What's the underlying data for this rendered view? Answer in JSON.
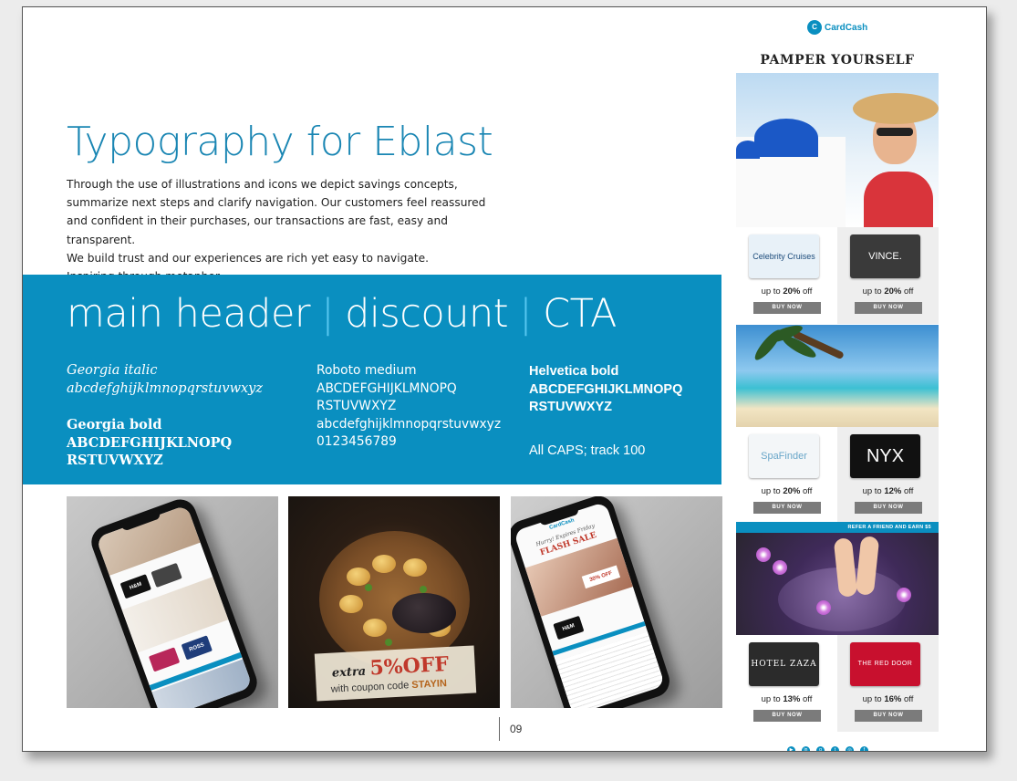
{
  "page": {
    "title": "Typography for Eblast",
    "intro": [
      "Through the use of illustrations and icons we depict savings concepts,",
      "summarize next steps and clarify navigation. Our customers feel reassured",
      "and confident in their purchases, our transactions are fast, easy and transparent.",
      "We build trust and our experiences are rich yet easy to navigate.",
      "Inspiring through metaphor..."
    ],
    "page_number": "09"
  },
  "band": {
    "head_1": "main header",
    "head_sep": "|",
    "head_2": "discount",
    "head_3": "CTA",
    "georgia_italic_label": "Georgia italic",
    "georgia_italic_sample": "abcdefghijklmnopqrstuvwxyz",
    "georgia_bold_label": "Georgia bold",
    "georgia_bold_sample_1": "ABCDEFGHIJKLNOPQ",
    "georgia_bold_sample_2": "RSTUVWXYZ",
    "roboto_label": "Roboto medium",
    "roboto_sample_1": "ABCDEFGHIJKLMNOPQ",
    "roboto_sample_2": "RSTUVWXYZ",
    "roboto_sample_3": "abcdefghijklmnopqrstuvwxyz",
    "roboto_sample_4": "0123456789",
    "helv_label": "Helvetica bold",
    "helv_sample_1": "ABCDEFGHIJKLMNOPQ",
    "helv_sample_2": "RSTUVWXYZ",
    "helv_note": "All CAPS; track 100"
  },
  "thumbs": {
    "food_promo_prefix": "extra",
    "food_promo_value": "5%OFF",
    "food_promo_code_text": "with coupon code",
    "food_promo_code": "STAYIN",
    "phone1_store_1": "H&M",
    "phone1_store_2": "ROSS",
    "phone3_banner": "Hurry! Expires Friday",
    "phone3_sale": "FLASH SALE",
    "phone3_off": "30% OFF",
    "phone3_store": "H&M",
    "phone3_logo": "CardCash"
  },
  "eblast": {
    "logo": "CardCash",
    "headline": "PAMPER YOURSELF",
    "refer": "REFER A FRIEND AND EARN $5",
    "buy_label": "BUY NOW",
    "off_prefix": "up to",
    "off_suffix": "off",
    "cards": [
      {
        "name": "Celebrity Cruises",
        "discount": "20%",
        "bg": "#e8f1f8",
        "fg": "#1b4a7a"
      },
      {
        "name": "VINCE.",
        "discount": "20%",
        "bg": "#3a3a3a",
        "fg": "#ffffff"
      },
      {
        "name": "SpaFinder",
        "discount": "20%",
        "bg": "#f3f6f8",
        "fg": "#6aa7c9"
      },
      {
        "name": "NYX",
        "discount": "12%",
        "bg": "#111111",
        "fg": "#ffffff"
      },
      {
        "name": "HOTEL ZAZA",
        "discount": "13%",
        "bg": "#2b2b2b",
        "fg": "#ffffff"
      },
      {
        "name": "THE RED DOOR",
        "discount": "16%",
        "bg": "#c8102e",
        "fg": "#ffffff"
      }
    ],
    "social_icons": [
      "youtube-icon",
      "linkedin-icon",
      "googleplus-icon",
      "twitter-icon",
      "instagram-icon",
      "facebook-icon"
    ]
  },
  "colors": {
    "accent": "#0a8fc0",
    "title": "#1a86b3",
    "button": "#7b7b7b"
  }
}
